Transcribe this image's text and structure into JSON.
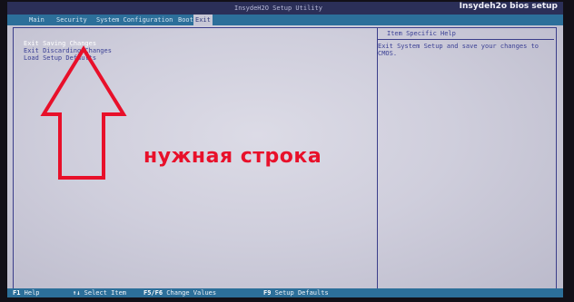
{
  "header": {
    "brand": "Insydeh2o bios setup",
    "title": "InsydeH2O Setup Utility"
  },
  "tabs": [
    "Main",
    "Security",
    "System Configuration",
    "Boot",
    "Exit"
  ],
  "active_tab": "Exit",
  "exit_menu": {
    "items": [
      "Exit Saving Changes",
      "Exit Discarding Changes",
      "Load Setup Defaults"
    ],
    "selected": "Exit Saving Changes"
  },
  "help_panel": {
    "title": "Item Specific Help",
    "text": "Exit System Setup and save your changes to CMOS."
  },
  "key_legend": [
    {
      "key": "F1",
      "label": "Help"
    },
    {
      "key": "↑↓",
      "label": "Select Item"
    },
    {
      "key": "F5/F6",
      "label": "Change Values"
    },
    {
      "key": "F9",
      "label": "Setup Defaults"
    }
  ],
  "annotation": {
    "text": "нужная строка",
    "color": "#e8102a"
  }
}
